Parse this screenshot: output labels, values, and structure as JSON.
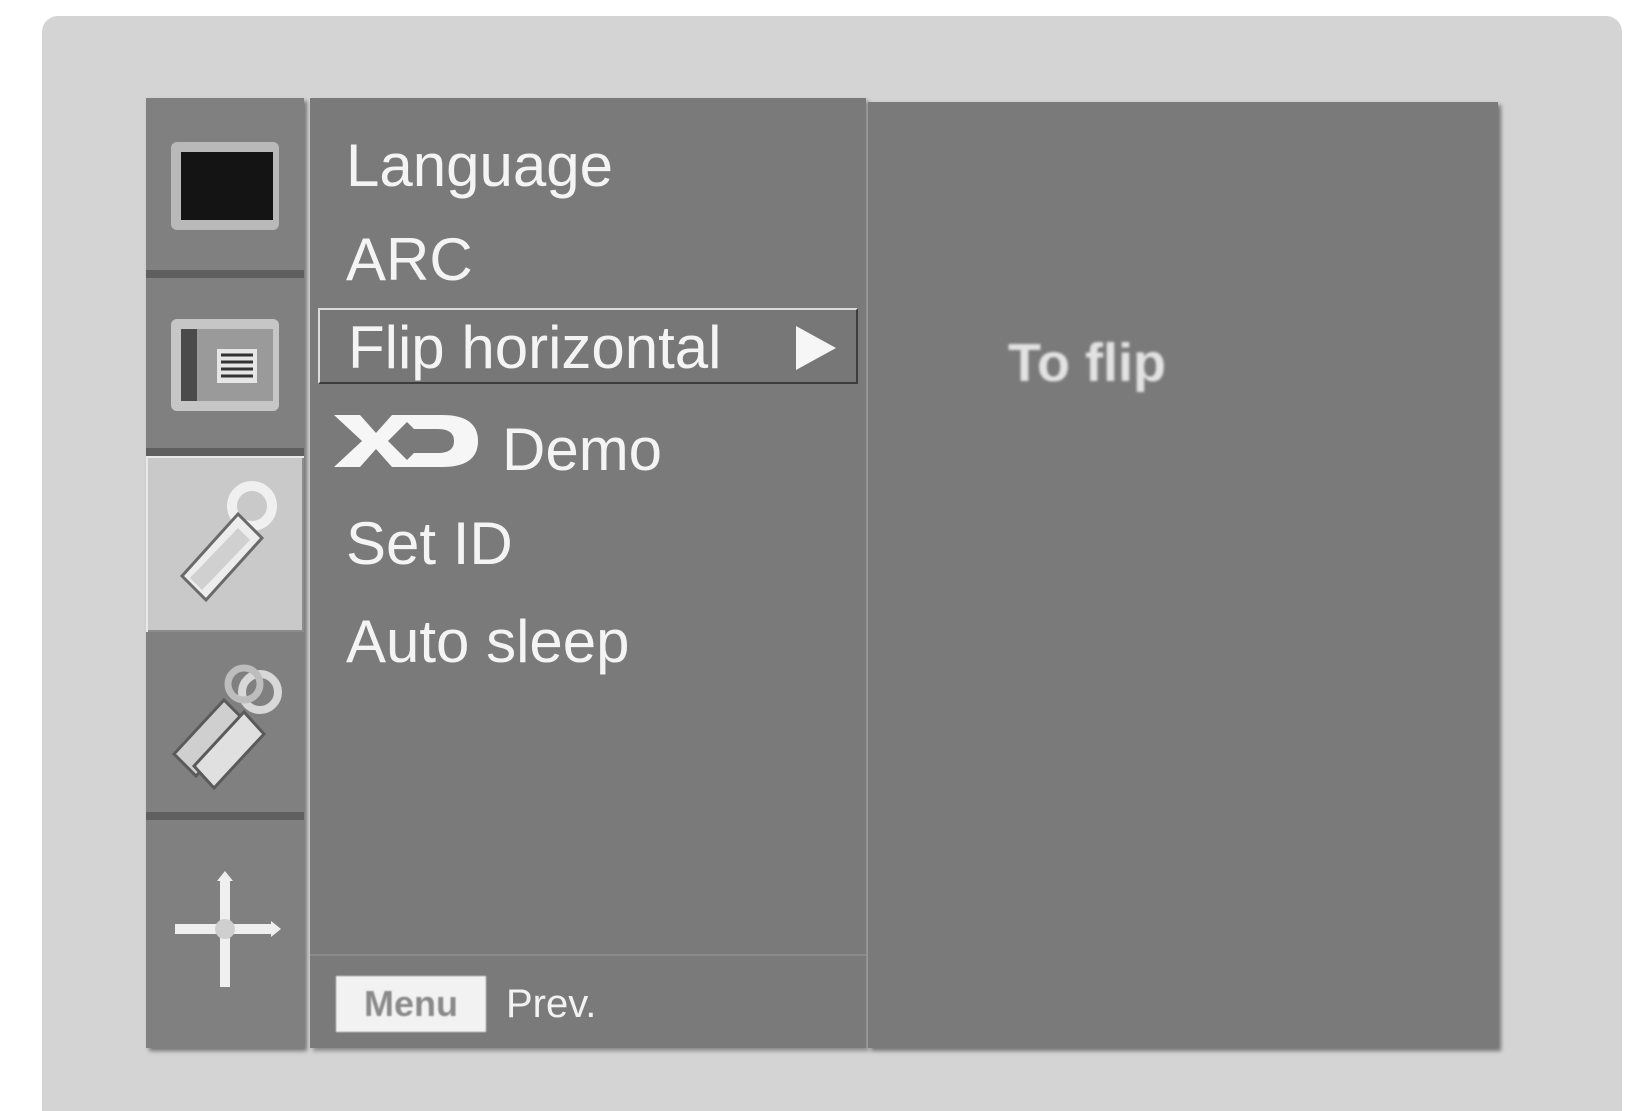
{
  "sidebar": {
    "tabs": [
      {
        "name": "picture",
        "icon": "picture-screen-icon"
      },
      {
        "name": "pip",
        "icon": "pip-screen-icon"
      },
      {
        "name": "special",
        "icon": "special-tag-icon",
        "active": true
      },
      {
        "name": "setup",
        "icon": "setup-tags-icon"
      },
      {
        "name": "screen",
        "icon": "screen-adjust-cross-icon"
      }
    ]
  },
  "menu": {
    "items": [
      {
        "label": "Language"
      },
      {
        "label": "ARC"
      },
      {
        "label": "Flip horizontal",
        "selected": true
      },
      {
        "label": "Demo",
        "logo": "XD"
      },
      {
        "label": "Set ID"
      },
      {
        "label": "Auto sleep"
      }
    ],
    "footer": {
      "key_label": "Menu",
      "prev_label": "Prev."
    }
  },
  "description": {
    "text": "To flip"
  },
  "colors": {
    "panel": "#7a7a7a",
    "frame": "#d4d4d4",
    "text": "#f4f4f4",
    "active_tab": "#c9c9c9"
  }
}
